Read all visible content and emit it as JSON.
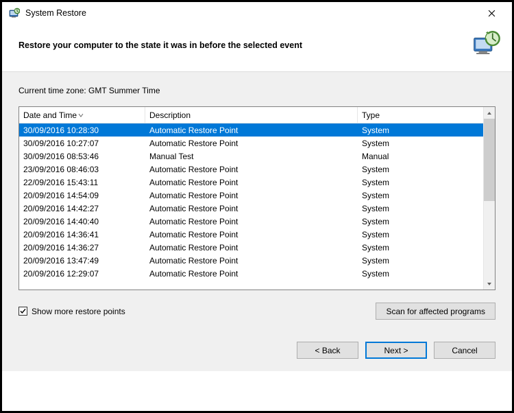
{
  "window": {
    "title": "System Restore"
  },
  "header": {
    "heading": "Restore your computer to the state it was in before the selected event"
  },
  "timezone": {
    "label": "Current time zone: GMT Summer Time"
  },
  "columns": {
    "date": "Date and Time",
    "desc": "Description",
    "type": "Type"
  },
  "rows": [
    {
      "date": "30/09/2016 10:28:30",
      "desc": "Automatic Restore Point",
      "type": "System",
      "selected": true
    },
    {
      "date": "30/09/2016 10:27:07",
      "desc": "Automatic Restore Point",
      "type": "System"
    },
    {
      "date": "30/09/2016 08:53:46",
      "desc": "Manual Test",
      "type": "Manual"
    },
    {
      "date": "23/09/2016 08:46:03",
      "desc": "Automatic Restore Point",
      "type": "System"
    },
    {
      "date": "22/09/2016 15:43:11",
      "desc": "Automatic Restore Point",
      "type": "System"
    },
    {
      "date": "20/09/2016 14:54:09",
      "desc": "Automatic Restore Point",
      "type": "System"
    },
    {
      "date": "20/09/2016 14:42:27",
      "desc": "Automatic Restore Point",
      "type": "System"
    },
    {
      "date": "20/09/2016 14:40:40",
      "desc": "Automatic Restore Point",
      "type": "System"
    },
    {
      "date": "20/09/2016 14:36:41",
      "desc": "Automatic Restore Point",
      "type": "System"
    },
    {
      "date": "20/09/2016 14:36:27",
      "desc": "Automatic Restore Point",
      "type": "System"
    },
    {
      "date": "20/09/2016 13:47:49",
      "desc": "Automatic Restore Point",
      "type": "System"
    },
    {
      "date": "20/09/2016 12:29:07",
      "desc": "Automatic Restore Point",
      "type": "System"
    }
  ],
  "controls": {
    "checkbox_label": "Show more restore points",
    "checkbox_checked": true,
    "scan_button": "Scan for affected programs"
  },
  "footer": {
    "back": "< Back",
    "next": "Next >",
    "cancel": "Cancel"
  }
}
